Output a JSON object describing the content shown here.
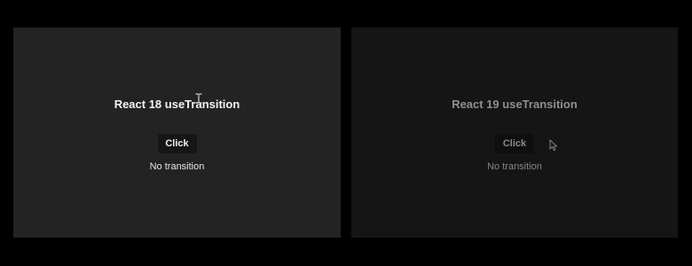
{
  "panels": {
    "left": {
      "title": "React 18 useTransition",
      "button_label": "Click",
      "status": "No transition"
    },
    "right": {
      "title": "React 19 useTransition",
      "button_label": "Click",
      "status": "No transition"
    }
  },
  "cursors": {
    "left": "text-cursor-icon",
    "right": "arrow-pointer-icon"
  },
  "colors": {
    "background": "#000000",
    "left_panel": "#232323",
    "right_panel": "#151515"
  }
}
